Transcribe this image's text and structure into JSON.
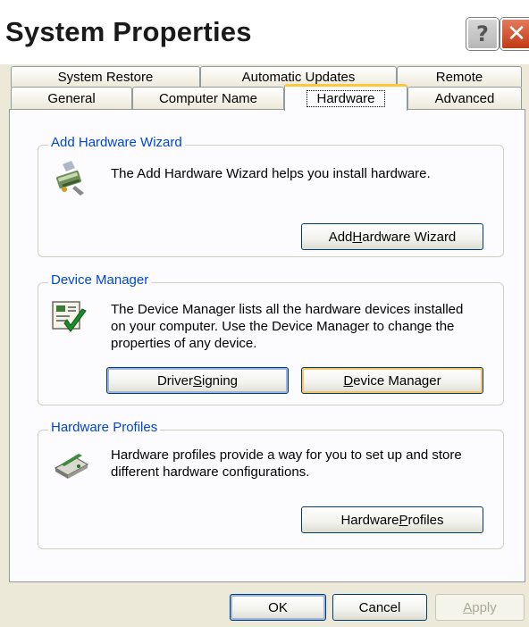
{
  "window": {
    "title": "System Properties",
    "help_glyph": "?",
    "close_glyph": "✕"
  },
  "tabs": {
    "row1": [
      "System Restore",
      "Automatic Updates",
      "Remote"
    ],
    "row2": [
      "General",
      "Computer Name",
      "Hardware",
      "Advanced"
    ],
    "active": "Hardware"
  },
  "add_hardware": {
    "title": "Add Hardware Wizard",
    "description": "The Add Hardware Wizard helps you install hardware.",
    "button_pre": "Add ",
    "button_key": "H",
    "button_post": "ardware Wizard",
    "icon": "hardware-wizard-icon"
  },
  "device_manager": {
    "title": "Device Manager",
    "description_lines": [
      "The Device Manager lists all the hardware devices installed",
      "on your computer. Use the Device Manager to change the",
      "properties of any device."
    ],
    "driver_signing_pre": "Driver ",
    "driver_signing_key": "S",
    "driver_signing_post": "igning",
    "device_manager_key": "D",
    "device_manager_post": "evice Manager",
    "icon": "device-manager-icon"
  },
  "hardware_profiles": {
    "title": "Hardware Profiles",
    "description_lines": [
      "Hardware profiles provide a way for you to set up and store",
      "different hardware configurations."
    ],
    "button_pre": "Hardware ",
    "button_key": "P",
    "button_post": "rofiles",
    "icon": "hardware-profiles-icon"
  },
  "footer": {
    "ok": "OK",
    "cancel": "Cancel",
    "apply_key": "A",
    "apply_post": "pply"
  },
  "colors": {
    "group_title": "#0046d5",
    "active_tab_accent": "#ffc83c"
  }
}
